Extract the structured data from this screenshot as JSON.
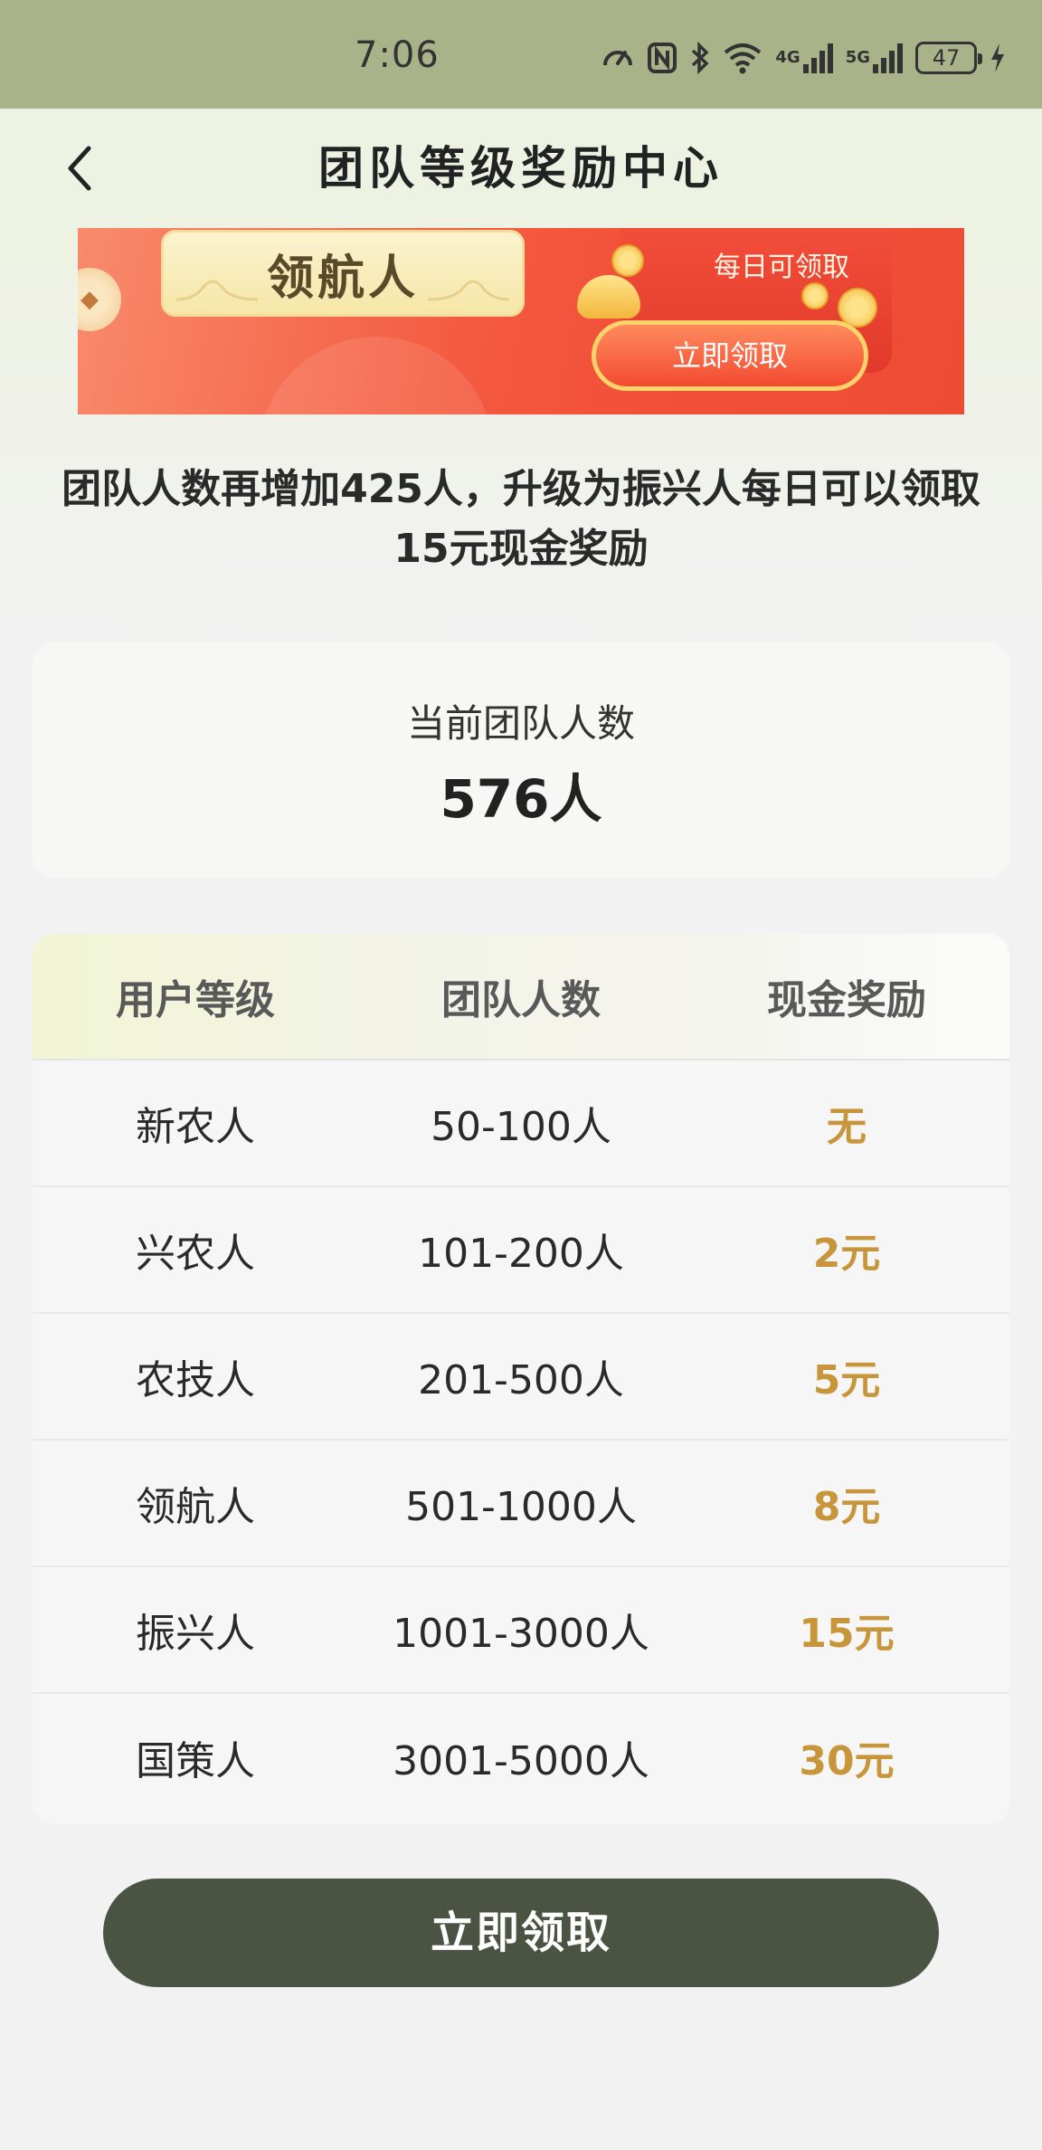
{
  "status_bar": {
    "time": "7:06",
    "network_1": "4G",
    "network_2": "5G",
    "battery": "47"
  },
  "header": {
    "title": "团队等级奖励中心",
    "back_icon": "chevron-left-icon"
  },
  "banner": {
    "current_level": "领航人",
    "daily_label": "每日可领取",
    "claim_label": "立即领取"
  },
  "tip": {
    "text": "团队人数再增加425人，升级为振兴人每日可以领取15元现金奖励"
  },
  "team_card": {
    "label": "当前团队人数",
    "value": "576人"
  },
  "levels_table": {
    "headers": [
      "用户等级",
      "团队人数",
      "现金奖励"
    ],
    "rows": [
      {
        "level": "新农人",
        "team": "50-100人",
        "reward": "无"
      },
      {
        "level": "兴农人",
        "team": "101-200人",
        "reward": "2元"
      },
      {
        "level": "农技人",
        "team": "201-500人",
        "reward": "5元"
      },
      {
        "level": "领航人",
        "team": "501-1000人",
        "reward": "8元"
      },
      {
        "level": "振兴人",
        "team": "1001-3000人",
        "reward": "15元"
      },
      {
        "level": "国策人",
        "team": "3001-5000人",
        "reward": "30元"
      }
    ]
  },
  "claim_button": {
    "label": "立即领取"
  },
  "colors": {
    "status_bar_bg": "#aab28a",
    "header_bg": "#eef2e2",
    "reward_gold": "#c8963a",
    "primary_button": "#4b5443",
    "banner_red": "#f2523a"
  }
}
